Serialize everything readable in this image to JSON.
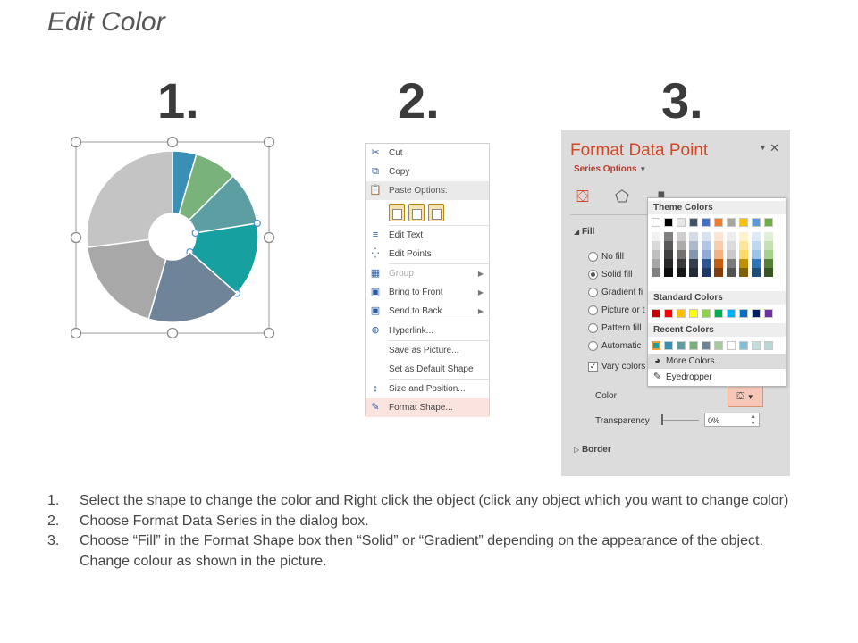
{
  "title": "Edit Color",
  "steps": [
    "1.",
    "2.",
    "3."
  ],
  "donut": {
    "segments": [
      {
        "value": 4.5,
        "color": "#3a8fb5"
      },
      {
        "value": 8,
        "color": "#79b27a"
      },
      {
        "value": 10,
        "color": "#5d9ea3"
      },
      {
        "value": 14,
        "color": "#17a0a0"
      },
      {
        "value": 18,
        "color": "#6f8498"
      },
      {
        "value": 18.5,
        "color": "#a8a8a8"
      },
      {
        "value": 27,
        "color": "#c4c4c4"
      }
    ]
  },
  "context_menu": {
    "items": [
      {
        "label": "Cut",
        "icon": "scissors-icon",
        "glyph": "✂"
      },
      {
        "label": "Copy",
        "icon": "copy-icon",
        "glyph": "⧉"
      }
    ],
    "paste_label": "Paste Options:",
    "items2": [
      {
        "label": "Edit Text",
        "icon": "edit-text-icon",
        "glyph": "≡"
      },
      {
        "label": "Edit Points",
        "icon": "edit-points-icon",
        "glyph": "⁛"
      },
      {
        "label": "Group",
        "icon": "group-icon",
        "glyph": "▦"
      },
      {
        "label": "Bring to Front",
        "icon": "bring-front-icon",
        "glyph": "▣"
      },
      {
        "label": "Send to Back",
        "icon": "send-back-icon",
        "glyph": "▣"
      },
      {
        "label": "Hyperlink...",
        "icon": "hyperlink-icon",
        "glyph": "⊕"
      },
      {
        "label": "Save as Picture..."
      },
      {
        "label": "Set as Default Shape"
      },
      {
        "label": "Size and Position...",
        "icon": "size-position-icon",
        "glyph": "↕"
      },
      {
        "label": "Format Shape...",
        "icon": "format-shape-icon",
        "glyph": "✎"
      }
    ]
  },
  "format_pane": {
    "title": "Format Data Point",
    "series_options": "Series Options",
    "fill_label": "Fill",
    "fill_options": [
      "No fill",
      "Solid fill",
      "Gradient fi",
      "Picture or t",
      "Pattern fill",
      "Automatic"
    ],
    "vary_colors": "Vary colors",
    "color_label": "Color",
    "transparency_label": "Transparency",
    "transparency_value": "0%",
    "border_label": "Border",
    "accent": "#d24726"
  },
  "color_popup": {
    "theme_label": "Theme Colors",
    "standard_label": "Standard Colors",
    "recent_label": "Recent Colors",
    "more_colors": "More Colors...",
    "eyedropper": "Eyedropper",
    "theme_top": [
      "#ffffff",
      "#000000",
      "#e7e6e6",
      "#44546a",
      "#4472c4",
      "#ed7d31",
      "#a5a5a5",
      "#ffc000",
      "#5b9bd5",
      "#70ad47"
    ],
    "theme_shades": [
      [
        "#f2f2f2",
        "#d9d9d9",
        "#bfbfbf",
        "#a6a6a6",
        "#808080"
      ],
      [
        "#808080",
        "#595959",
        "#404040",
        "#262626",
        "#0d0d0d"
      ],
      [
        "#d0cece",
        "#aeabab",
        "#757171",
        "#3a3838",
        "#171616"
      ],
      [
        "#d6dce4",
        "#adb9ca",
        "#8496b0",
        "#333f4f",
        "#222a35"
      ],
      [
        "#d9e2f3",
        "#b4c6e7",
        "#8eaadb",
        "#2f5496",
        "#1f3864"
      ],
      [
        "#fbe5d5",
        "#f7cbac",
        "#f4b183",
        "#c55a11",
        "#833c0b"
      ],
      [
        "#ededed",
        "#dbdbdb",
        "#c9c9c9",
        "#7b7b7b",
        "#525252"
      ],
      [
        "#fff2cc",
        "#fee599",
        "#ffd965",
        "#bf8f00",
        "#7f6000"
      ],
      [
        "#deebf6",
        "#bdd7ee",
        "#9dc3e6",
        "#2e75b5",
        "#1e4e79"
      ],
      [
        "#e2efd9",
        "#c5e0b3",
        "#a8d08d",
        "#538135",
        "#375623"
      ]
    ],
    "standard": [
      "#c00000",
      "#ff0000",
      "#ffc000",
      "#ffff00",
      "#92d050",
      "#00b050",
      "#00b0f0",
      "#0070c0",
      "#002060",
      "#7030a0"
    ],
    "recent": [
      "#17a0a0",
      "#3a8fb5",
      "#5d9ea3",
      "#79b27a",
      "#6f8498",
      "#a8c8a0",
      "#ffffff",
      "#7fc0d8",
      "#c0e0e0",
      "#b8d8d8"
    ]
  },
  "instructions": [
    {
      "n": "1.",
      "text": "Select the shape to change the color and Right click the object (click any object which you want to change color)"
    },
    {
      "n": "2.",
      "text": "Choose Format Data Series in the dialog box."
    },
    {
      "n": "3.",
      "text": "Choose “Fill” in the Format Shape box then “Solid” or “Gradient” depending on the appearance of the object. Change colour as shown in the picture."
    }
  ]
}
